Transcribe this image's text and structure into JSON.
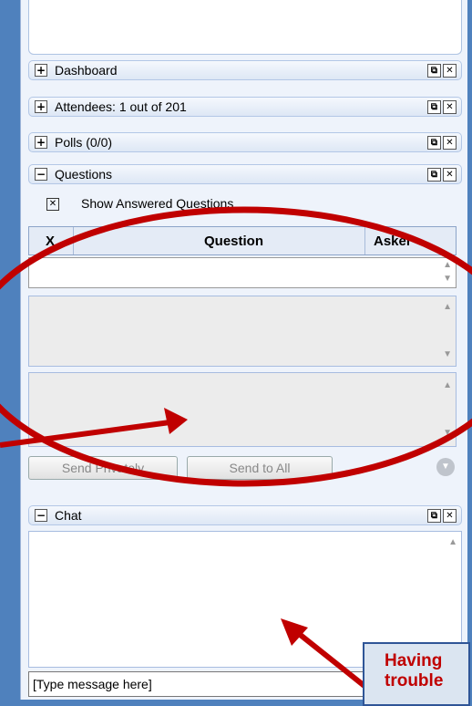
{
  "sections": [
    {
      "label": "Dashboard",
      "toggle": "+"
    },
    {
      "label": "Attendees:  1 out of 201",
      "toggle": "+"
    },
    {
      "label": "Polls (0/0)",
      "toggle": "+"
    },
    {
      "label": "Questions",
      "toggle": "−"
    }
  ],
  "questions": {
    "show_answered_label": "Show Answered Questions",
    "columns": [
      "X",
      "Question",
      "Asker"
    ],
    "send_privately_label": "Send Privately",
    "send_to_all_label": "Send to All"
  },
  "chat": {
    "label": "Chat",
    "toggle": "−",
    "message_placeholder": "[Type message here]"
  },
  "callout": {
    "line1": "Having",
    "line2": "trouble"
  },
  "colors": {
    "background": "#4f81bd",
    "annotation": "#c00000"
  }
}
